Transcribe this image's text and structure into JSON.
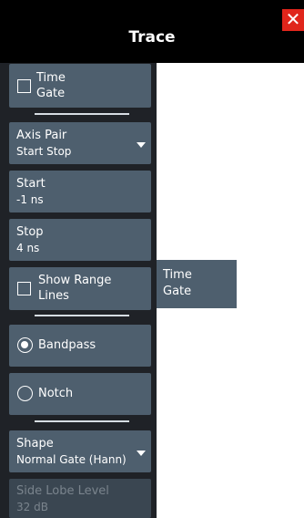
{
  "header": {
    "title": "Trace",
    "close_icon": "close-icon"
  },
  "menu": {
    "time_gate": {
      "label_line1": "Time",
      "label_line2": "Gate",
      "checked": false
    },
    "axis_pair": {
      "label": "Axis Pair",
      "value": "Start Stop"
    },
    "start": {
      "label": "Start",
      "value": "-1 ns"
    },
    "stop": {
      "label": "Stop",
      "value": "4 ns"
    },
    "show_range_lines": {
      "label_line1": "Show Range",
      "label_line2": "Lines",
      "checked": false
    },
    "bandpass": {
      "label": "Bandpass",
      "selected": true
    },
    "notch": {
      "label": "Notch",
      "selected": false
    },
    "shape": {
      "label": "Shape",
      "value": "Normal Gate (Hann)"
    },
    "side_lobe_level": {
      "label": "Side Lobe Level",
      "value": "32 dB",
      "enabled": false
    }
  },
  "tooltip": {
    "line1": "Time",
    "line2": "Gate"
  }
}
